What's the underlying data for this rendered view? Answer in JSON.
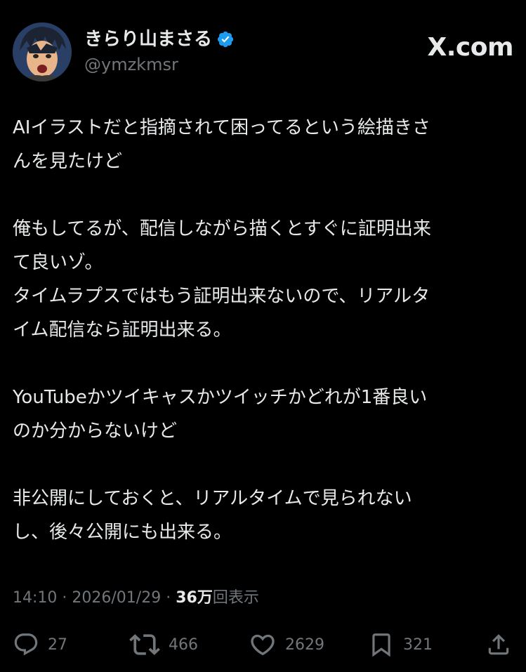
{
  "author": {
    "display_name": "きらり山まさる",
    "handle": "@ymzkmsr",
    "verified": true,
    "avatar_icon": "anime-character-avatar"
  },
  "brand": {
    "label": "X.com"
  },
  "tweet": {
    "paragraphs": [
      [
        "AIイラストだと指摘されて困ってるという絵描きさ",
        "んを見たけど"
      ],
      [
        "俺もしてるが、配信しながら描くとすぐに証明出来",
        "て良いゾ。",
        "タイムラプスではもう証明出来ないので、リアルタ",
        "イム配信なら証明出来る。"
      ],
      [
        "YouTubeかツイキャスかツイッチかどれが1番良い",
        "のか分からないけど"
      ],
      [
        "非公開にしておくと、リアルタイムで見られない",
        "し、後々公開にも出来る。"
      ]
    ]
  },
  "meta": {
    "time": "14:10",
    "separator": "·",
    "date": "2026/01/29",
    "views_count": "36万",
    "views_label": "回表示"
  },
  "actions": {
    "replies": "27",
    "reposts": "466",
    "likes": "2629",
    "bookmarks": "321"
  },
  "colors": {
    "background": "#000000",
    "text_primary": "#e7e9ea",
    "text_secondary": "#71767b",
    "verified_blue": "#1d9bf0"
  }
}
